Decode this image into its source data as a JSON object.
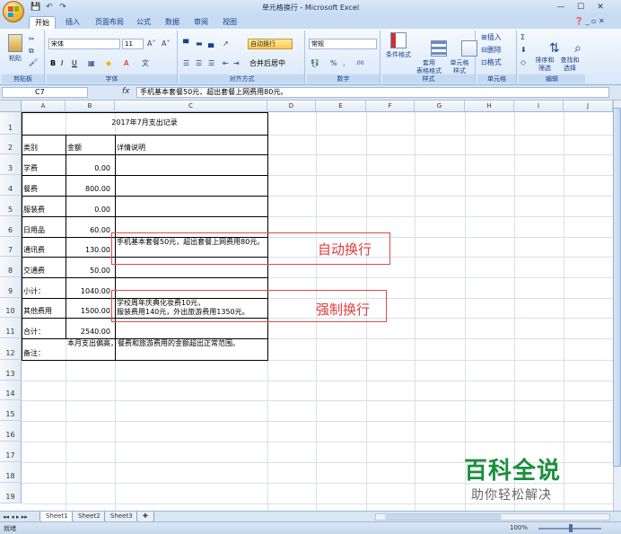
{
  "window": {
    "title": "单元格换行 - Microsoft Excel",
    "min": "—",
    "max": "☐",
    "close": "✕"
  },
  "qat": {
    "save": "💾",
    "undo": "↶",
    "redo": "↷"
  },
  "tabs": [
    "开始",
    "插入",
    "页面布局",
    "公式",
    "数据",
    "审阅",
    "视图"
  ],
  "help": "❓ _ ▫ ✕",
  "ribbon": {
    "clipboard": {
      "label": "剪贴板",
      "paste": "粘贴"
    },
    "font": {
      "label": "字体",
      "font_name": "宋体",
      "font_size": "11",
      "bold": "B",
      "italic": "I",
      "underline": "U",
      "grow": "A˄",
      "shrink": "A˅"
    },
    "alignment": {
      "label": "对齐方式",
      "wrap": "自动换行",
      "merge": "合并后居中"
    },
    "number": {
      "label": "数字",
      "format": "常规",
      "pct": "%",
      "comma": ","
    },
    "styles": {
      "label": "样式",
      "conditional": "条件格式",
      "table": "套用\n表格格式",
      "cell": "单元格\n样式"
    },
    "cells": {
      "label": "单元格",
      "insert": "插入",
      "delete": "删除",
      "format": "格式"
    },
    "editing": {
      "label": "编辑",
      "sort": "排序和\n筛选",
      "find": "查找和\n选择"
    }
  },
  "formula_bar": {
    "name_box": "C7",
    "fx": "fx",
    "content": "手机基本套餐50元，超出套餐上网费用80元。"
  },
  "columns": [
    "A",
    "B",
    "C",
    "D",
    "E",
    "F",
    "G",
    "H",
    "I",
    "J"
  ],
  "rows": [
    "1",
    "2",
    "3",
    "4",
    "5",
    "6",
    "7",
    "8",
    "9",
    "10",
    "11",
    "12",
    "13",
    "14",
    "15",
    "16",
    "17",
    "18",
    "19"
  ],
  "sheet": {
    "title": "2017年7月支出记录",
    "headers": {
      "type": "类别",
      "amount": "金额",
      "detail": "详情说明"
    },
    "data": [
      {
        "type": "学费",
        "amount": "0.00",
        "detail": ""
      },
      {
        "type": "餐费",
        "amount": "800.00",
        "detail": ""
      },
      {
        "type": "服装费",
        "amount": "0.00",
        "detail": ""
      },
      {
        "type": "日用品",
        "amount": "60.00",
        "detail": ""
      },
      {
        "type": "通讯费",
        "amount": "130.00",
        "detail": "手机基本套餐50元，超出套餐上网费用80元。"
      },
      {
        "type": "交通费",
        "amount": "50.00",
        "detail": ""
      },
      {
        "type": "小计：",
        "amount": "1040.00",
        "detail": ""
      },
      {
        "type": "其他费用",
        "amount": "1500.00",
        "detail": "学校周年庆典化妆费10元，\n服装费用140元，外出旅游费用1350元。"
      },
      {
        "type": "合计：",
        "amount": "2540.00",
        "detail": ""
      }
    ],
    "note": {
      "label": "备注：",
      "text": "本月支出偏高，餐费和旅游费用的金额超出正常范围。"
    }
  },
  "annotations": {
    "auto_wrap": "自动换行",
    "forced_wrap": "强制换行"
  },
  "watermark": {
    "main": "百科全说",
    "sub": "助你轻松解决"
  },
  "sheet_tabs": [
    "Sheet1",
    "Sheet2",
    "Sheet3"
  ],
  "status": {
    "ready": "就绪",
    "zoom": "100%"
  },
  "colors": {
    "annotation": "#e03c3c",
    "watermark": "#1a8f3c",
    "ribbon": "#d9e7f8"
  }
}
